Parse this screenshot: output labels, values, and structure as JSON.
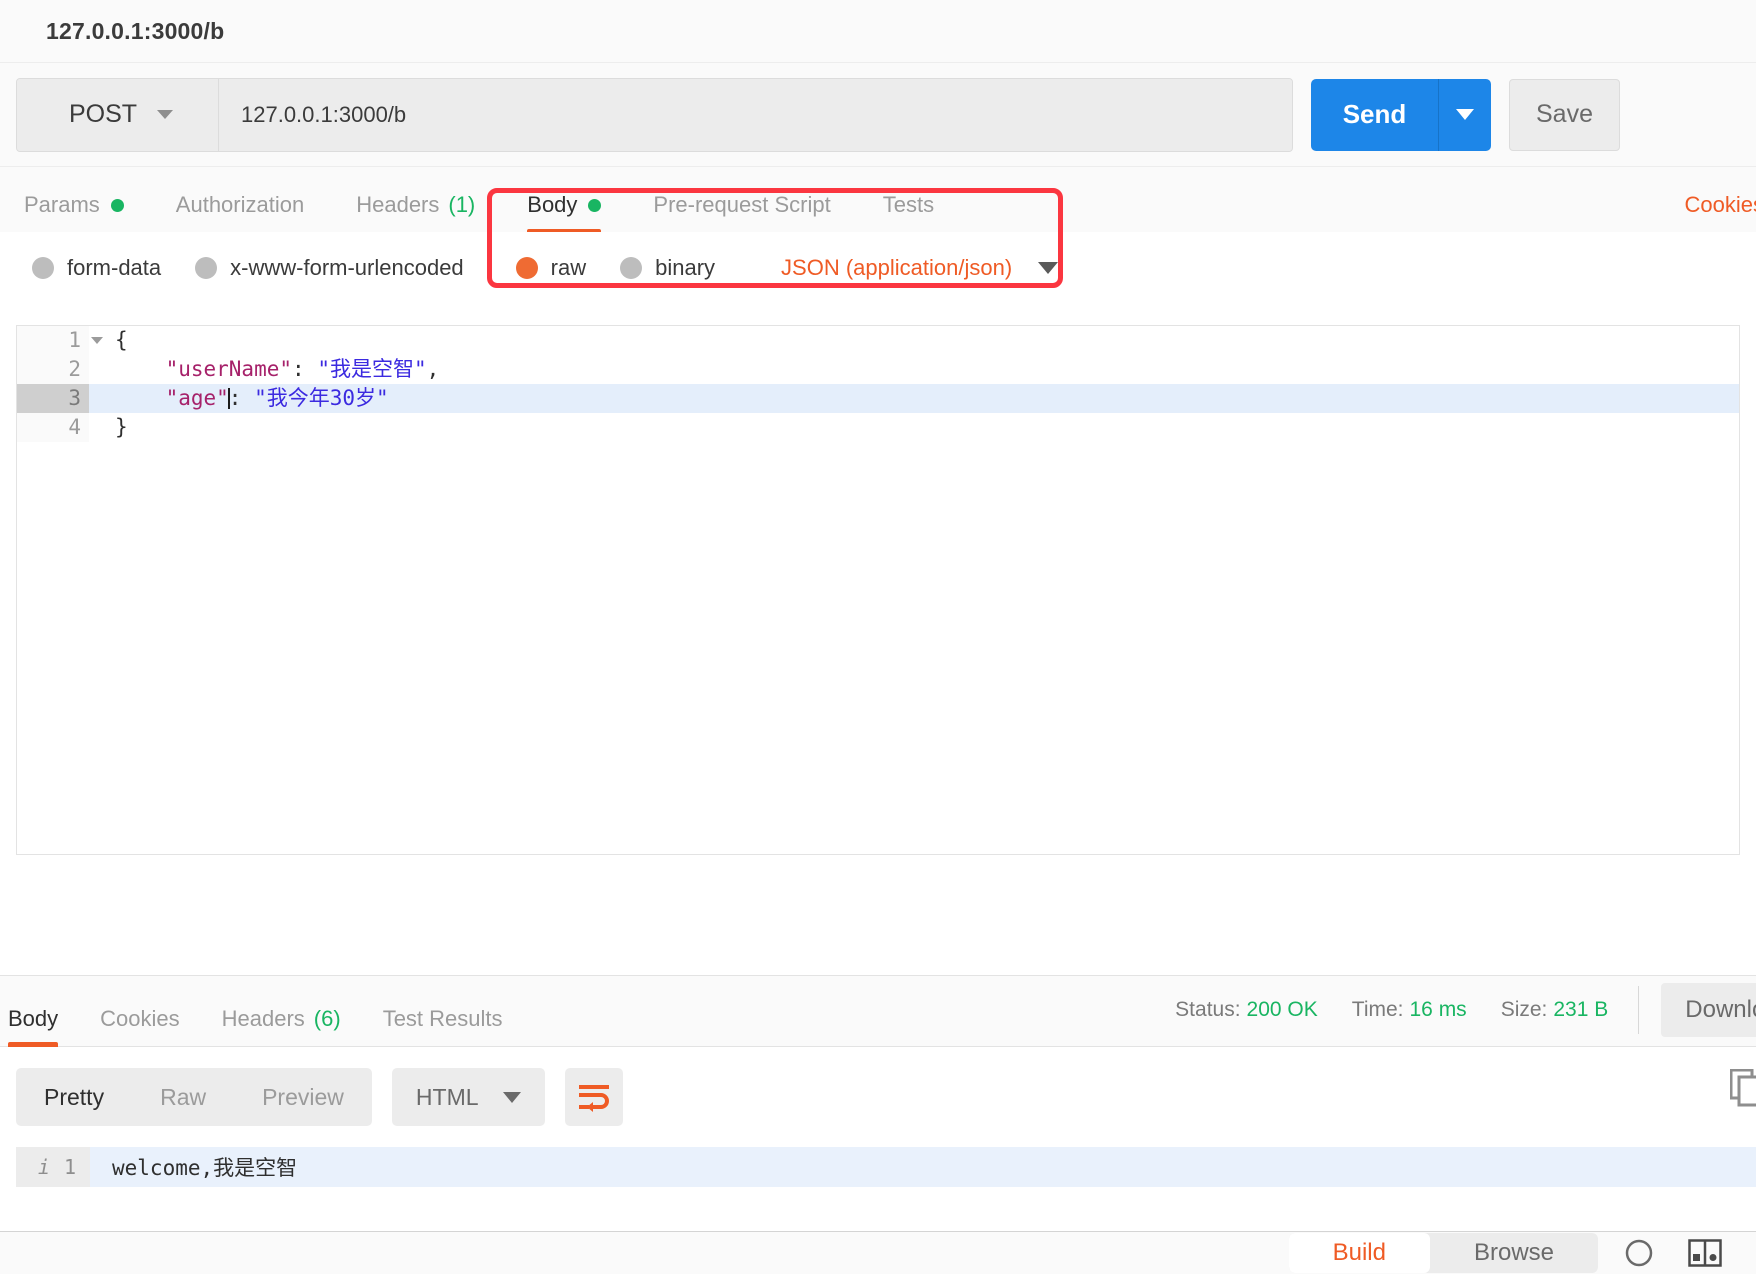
{
  "request": {
    "title": "127.0.0.1:3000/b",
    "method": "POST",
    "url": "127.0.0.1:3000/b",
    "send_label": "Send",
    "save_label": "Save",
    "cookies_link": "Cookies",
    "tabs": [
      {
        "label": "Params",
        "dot": true,
        "count": "",
        "active": false
      },
      {
        "label": "Authorization",
        "dot": false,
        "count": "",
        "active": false
      },
      {
        "label": "Headers",
        "dot": false,
        "count": "(1)",
        "active": false
      },
      {
        "label": "Body",
        "dot": true,
        "count": "",
        "active": true
      },
      {
        "label": "Pre-request Script",
        "dot": false,
        "count": "",
        "active": false
      },
      {
        "label": "Tests",
        "dot": false,
        "count": "",
        "active": false
      }
    ],
    "body_types": [
      {
        "label": "form-data",
        "selected": false
      },
      {
        "label": "x-www-form-urlencoded",
        "selected": false
      },
      {
        "label": "raw",
        "selected": true
      },
      {
        "label": "binary",
        "selected": false
      }
    ],
    "content_type": "JSON (application/json)",
    "editor_lines": [
      {
        "num": "1",
        "fold": true,
        "highlight": false,
        "segments": [
          {
            "t": "{",
            "c": "p"
          }
        ]
      },
      {
        "num": "2",
        "fold": false,
        "highlight": false,
        "segments": [
          {
            "t": "    \"userName\"",
            "c": "k"
          },
          {
            "t": ": ",
            "c": "p"
          },
          {
            "t": "\"我是空智\"",
            "c": "s"
          },
          {
            "t": ",",
            "c": "p"
          }
        ]
      },
      {
        "num": "3",
        "fold": false,
        "highlight": true,
        "segments": [
          {
            "t": "    \"age\"",
            "c": "k"
          },
          {
            "t": ": ",
            "c": "p"
          },
          {
            "t": "\"我今年30岁\"",
            "c": "s"
          }
        ]
      },
      {
        "num": "4",
        "fold": false,
        "highlight": false,
        "segments": [
          {
            "t": "}",
            "c": "p"
          }
        ]
      }
    ]
  },
  "response": {
    "tabs": [
      {
        "label": "Body",
        "count": "",
        "active": true
      },
      {
        "label": "Cookies",
        "count": "",
        "active": false
      },
      {
        "label": "Headers",
        "count": "(6)",
        "active": false
      },
      {
        "label": "Test Results",
        "count": "",
        "active": false
      }
    ],
    "status_label": "Status:",
    "status_value": "200 OK",
    "time_label": "Time:",
    "time_value": "16 ms",
    "size_label": "Size:",
    "size_value": "231 B",
    "download_label": "Download",
    "view_modes": [
      {
        "label": "Pretty",
        "active": true
      },
      {
        "label": "Raw",
        "active": false
      },
      {
        "label": "Preview",
        "active": false
      }
    ],
    "format": "HTML",
    "body_line_number": "1",
    "body_text": "welcome,我是空智"
  },
  "footer": {
    "build_label": "Build",
    "browse_label": "Browse"
  },
  "colors": {
    "accent_orange": "#ef5b25",
    "send_blue": "#1d86e8",
    "success_green": "#19b562",
    "annotation_red": "#fb3640"
  }
}
